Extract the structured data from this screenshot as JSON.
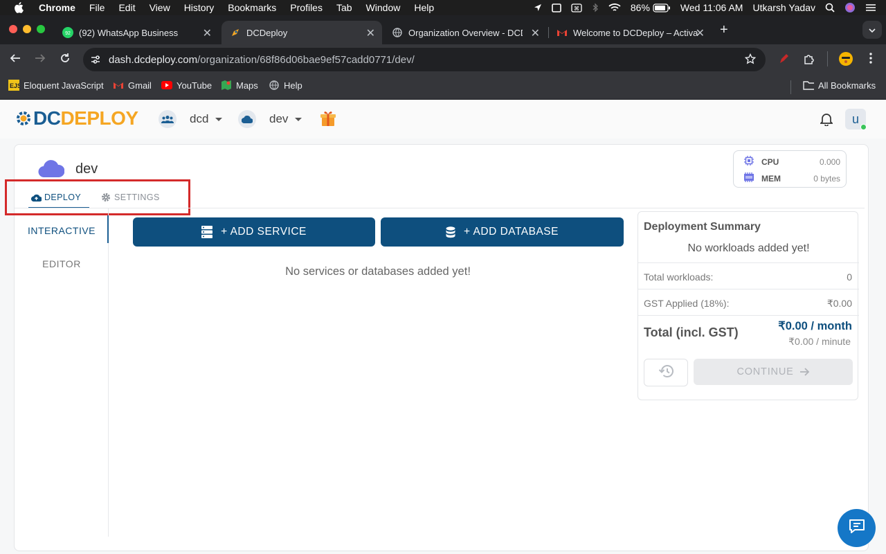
{
  "menubar": {
    "items": [
      "Chrome",
      "File",
      "Edit",
      "View",
      "History",
      "Bookmarks",
      "Profiles",
      "Tab",
      "Window",
      "Help"
    ],
    "battery": "86%",
    "datetime": "Wed 11:06 AM",
    "user": "Utkarsh Yadav"
  },
  "tabs": [
    {
      "title": "(92) WhatsApp Business",
      "icon": "whatsapp-icon",
      "badge": "92"
    },
    {
      "title": "DCDeploy",
      "icon": "dcdeploy-favicon"
    },
    {
      "title": "Organization Overview - DCDeploy",
      "icon": "globe-icon"
    },
    {
      "title": "Welcome to DCDeploy – Activate",
      "icon": "gmail-icon"
    }
  ],
  "address": {
    "host": "dash.dcdeploy.com",
    "path": "/organization/68f86d06bae9ef57cadd0771/dev/"
  },
  "bookmarks": [
    {
      "label": "Eloquent JavaScript",
      "icon": "ejs-icon"
    },
    {
      "label": "Gmail",
      "icon": "gmail-icon"
    },
    {
      "label": "YouTube",
      "icon": "youtube-icon"
    },
    {
      "label": "Maps",
      "icon": "maps-icon"
    },
    {
      "label": "Help",
      "icon": "help-globe-icon"
    }
  ],
  "all_bookmarks": "All Bookmarks",
  "header": {
    "logo_a": "DC",
    "logo_b": "DEPLOY",
    "org": "dcd",
    "env": "dev",
    "avatar_letter": "u"
  },
  "env_title": "dev",
  "resources": {
    "cpu_label": "CPU",
    "cpu_value": "0.000",
    "mem_label": "MEM",
    "mem_value": "0 bytes"
  },
  "page_tabs": {
    "deploy": "DEPLOY",
    "settings": "SETTINGS"
  },
  "sidenav": {
    "interactive": "INTERACTIVE",
    "editor": "EDITOR"
  },
  "actions": {
    "add_service": "+ ADD SERVICE",
    "add_database": "+ ADD DATABASE"
  },
  "empty_text": "No services or databases added yet!",
  "summary": {
    "title": "Deployment Summary",
    "empty": "No workloads added yet!",
    "workloads_label": "Total workloads:",
    "workloads_value": "0",
    "gst_label": "GST Applied (18%):",
    "gst_value": "₹0.00",
    "total_label": "Total (incl. GST)",
    "total_month": "₹0.00 / month",
    "total_minute": "₹0.00 / minute",
    "continue": "CONTINUE"
  },
  "colors": {
    "accent": "#0e4f7e",
    "highlight": "#d42a2a",
    "brand_orange": "#f5a623"
  }
}
